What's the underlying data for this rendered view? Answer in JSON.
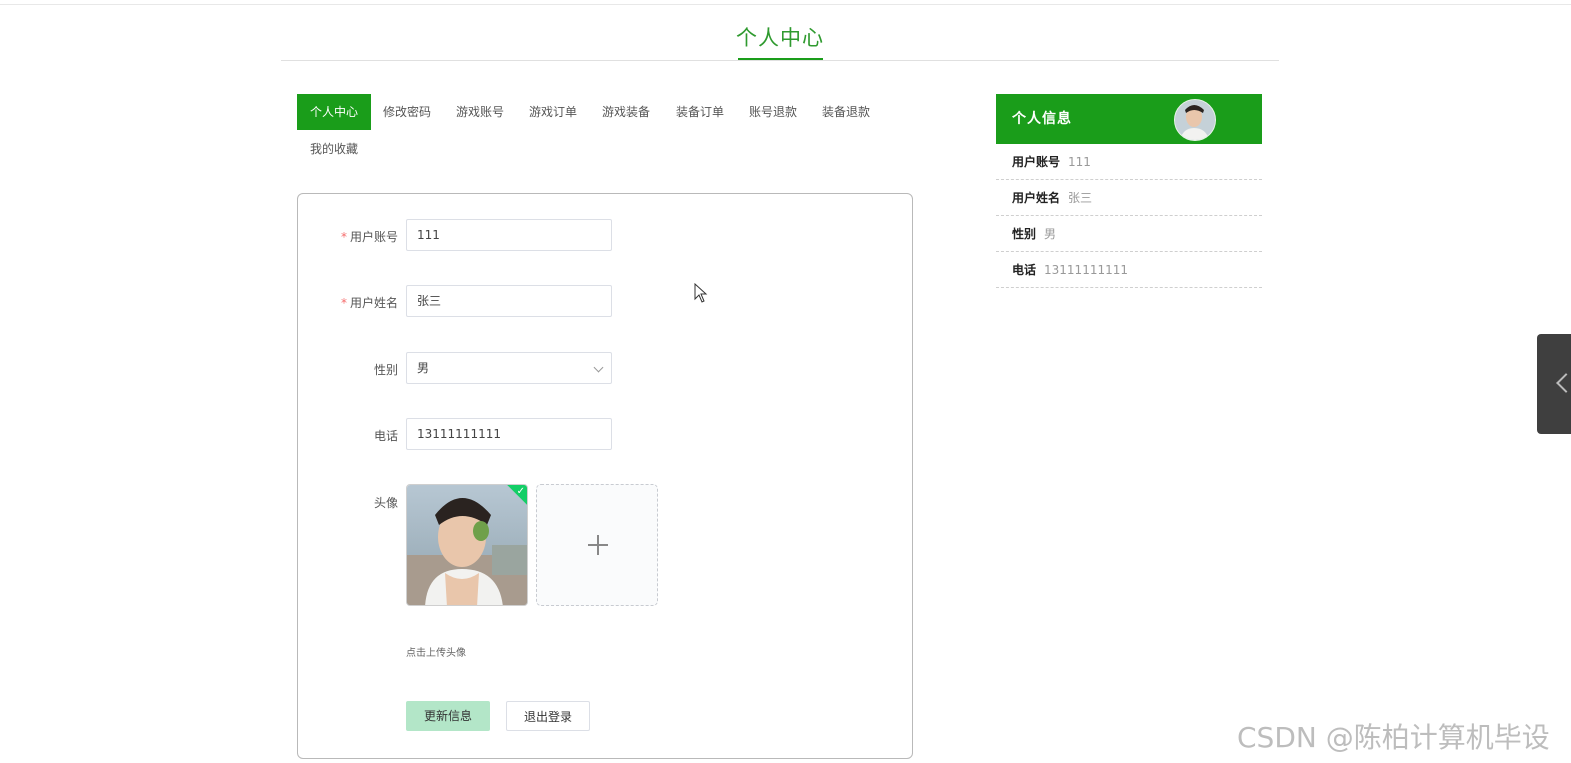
{
  "page": {
    "title": "个人中心"
  },
  "tabs": [
    {
      "label": "个人中心",
      "active": true
    },
    {
      "label": "修改密码"
    },
    {
      "label": "游戏账号"
    },
    {
      "label": "游戏订单"
    },
    {
      "label": "游戏装备"
    },
    {
      "label": "装备订单"
    },
    {
      "label": "账号退款"
    },
    {
      "label": "装备退款"
    },
    {
      "label": "我的收藏"
    }
  ],
  "form": {
    "account": {
      "label": "用户账号",
      "value": "111",
      "required": true
    },
    "name": {
      "label": "用户姓名",
      "value": "张三",
      "required": true
    },
    "gender": {
      "label": "性别",
      "value": "男"
    },
    "phone": {
      "label": "电话",
      "value": "13111111111"
    },
    "avatar": {
      "label": "头像",
      "tip": "点击上传头像"
    },
    "required_mark": "*",
    "update_button": "更新信息",
    "logout_button": "退出登录"
  },
  "info_panel": {
    "title": "个人信息",
    "rows": [
      {
        "key": "用户账号",
        "value": "111"
      },
      {
        "key": "用户姓名",
        "value": "张三"
      },
      {
        "key": "性别",
        "value": "男"
      },
      {
        "key": "电话",
        "value": "13111111111"
      }
    ]
  },
  "watermark": "CSDN @陈柏计算机毕设",
  "colors": {
    "accent": "#1a9d1a",
    "update_button": "#b3e6c8",
    "required": "#f56c6c"
  },
  "icons": {
    "side_toggle": "chevron-left-icon",
    "upload": "plus-icon",
    "upload_success": "check-icon"
  }
}
